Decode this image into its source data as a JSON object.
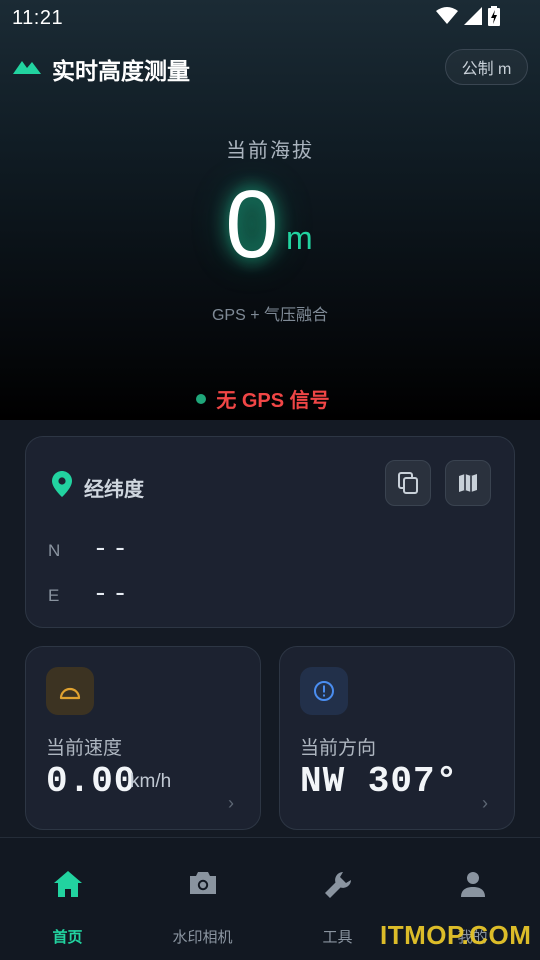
{
  "status_bar": {
    "time": "11:21"
  },
  "header": {
    "title": "实时高度测量",
    "unit_button": "公制 m"
  },
  "altitude": {
    "label": "当前海拔",
    "value": "0",
    "unit": "m",
    "source": "GPS + 气压融合",
    "gps_status": "无 GPS 信号"
  },
  "coordinates": {
    "title": "经纬度",
    "rows": [
      {
        "axis": "N",
        "value": "--"
      },
      {
        "axis": "E",
        "value": "--"
      }
    ]
  },
  "speed": {
    "label": "当前速度",
    "value": "0.00",
    "unit": "km/h"
  },
  "direction": {
    "label": "当前方向",
    "value": "NW 307°"
  },
  "bottom_nav": [
    {
      "label": "首页",
      "icon": "home-icon",
      "active": true
    },
    {
      "label": "水印相机",
      "icon": "camera-icon",
      "active": false
    },
    {
      "label": "工具",
      "icon": "wrench-icon",
      "active": false
    },
    {
      "label": "我的",
      "icon": "person-icon",
      "active": false
    }
  ],
  "watermark": "ITMOP.COM",
  "colors": {
    "accent": "#22d3a0",
    "error": "#f04646",
    "card": "#1c2230",
    "background": "#141a24"
  }
}
